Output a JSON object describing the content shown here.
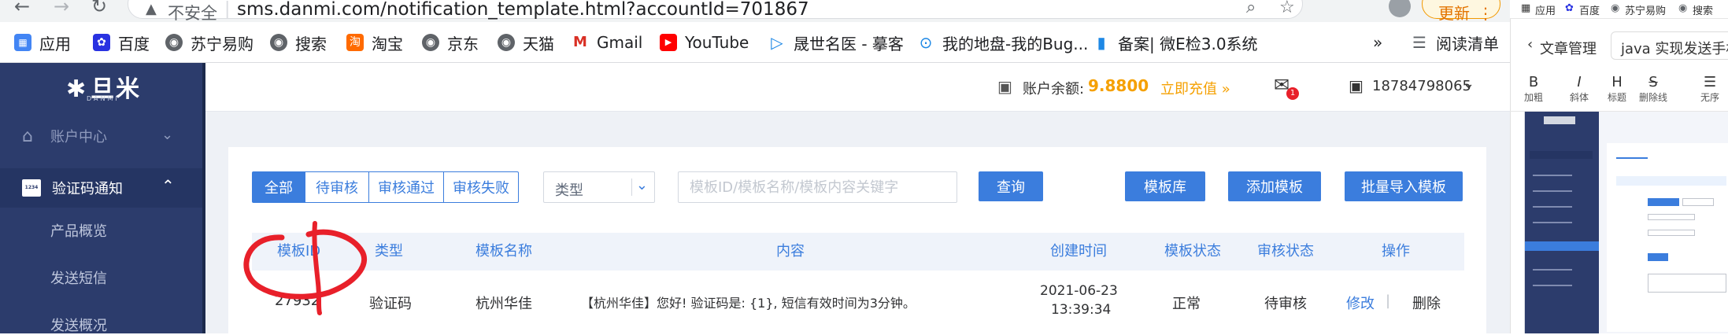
{
  "browser": {
    "insecure_label": "不安全",
    "url": "sms.danmi.com/notification_template.html?accountId=701867",
    "update_label": "更新",
    "bookmarks": [
      "应用",
      "百度",
      "苏宁易购",
      "搜索",
      "淘宝",
      "京东",
      "天猫",
      "Gmail",
      "YouTube",
      "晟世名医 - 摹客",
      "我的地盘-我的Bug...",
      "备案| 微E检3.0系统"
    ],
    "more": "»",
    "reading_list": "阅读清单"
  },
  "logo": {
    "text": "旦米",
    "sub": "DANMI"
  },
  "sidebar": {
    "account_center": "账户中心",
    "sms_notify": "验证码通知",
    "badge": "1234",
    "sub_items": [
      "产品概览",
      "发送短信",
      "发送概况"
    ]
  },
  "header": {
    "balance_label": "账户余额:",
    "balance_value": "9.8800",
    "recharge": "立即充值 »",
    "mail_badge": "1",
    "phone": "18784798065"
  },
  "filters": {
    "tabs": [
      "全部",
      "待审核",
      "审核通过",
      "审核失败"
    ],
    "type_placeholder": "类型",
    "search_placeholder": "模板ID/模板名称/模板内容关键字",
    "query": "查询",
    "template_lib": "模板库",
    "add_template": "添加模板",
    "bulk_import": "批量导入模板"
  },
  "table": {
    "headers": [
      "模板ID",
      "类型",
      "模板名称",
      "内容",
      "创建时间",
      "模板状态",
      "审核状态",
      "操作"
    ],
    "rows": [
      {
        "id": "27932",
        "type": "验证码",
        "name": "杭州华佳",
        "content": "【杭州华佳】您好! 验证码是: {1}, 短信有效时间为3分钟。",
        "date": "2021-06-23",
        "time": "13:39:34",
        "status": "正常",
        "review": "待审核",
        "edit": "修改",
        "delete": "删除"
      }
    ]
  },
  "right_panel": {
    "bookmarks": [
      "应用",
      "百度",
      "苏宁易购",
      "搜索"
    ],
    "back_label": "文章管理",
    "title_input": "java  实现发送手机",
    "tools": [
      {
        "glyph": "B",
        "label": "加粗"
      },
      {
        "glyph": "I",
        "label": "斜体"
      },
      {
        "glyph": "H",
        "label": "标题"
      },
      {
        "glyph": "S",
        "label": "删除线"
      },
      {
        "glyph": "☰",
        "label": "无序"
      }
    ]
  },
  "colors": {
    "accent": "#3b7ddd",
    "sidebar": "#2c3c6c",
    "balance": "#f5a000",
    "annotation": "#e8202a"
  }
}
